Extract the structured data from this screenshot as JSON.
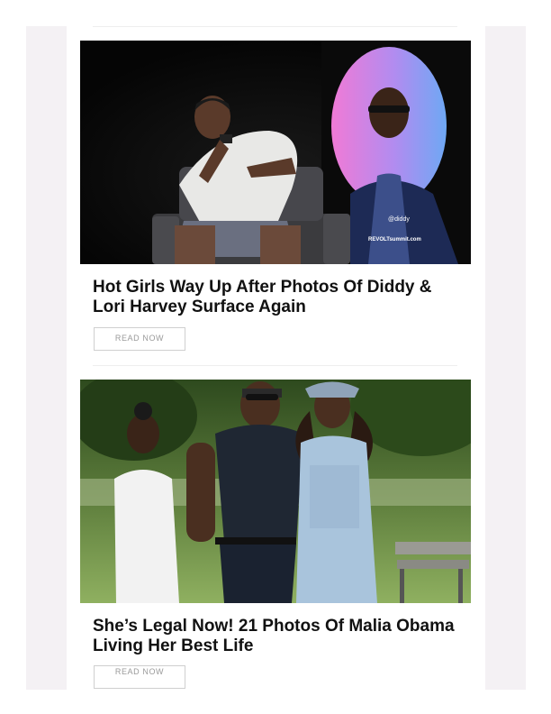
{
  "feed": {
    "articles": [
      {
        "image_alt": "Diddy on stage with microphone, @diddy and REVOLTsummit.com on backdrop screen",
        "headline": "Hot Girls Way Up After Photos Of Diddy & Lori Harvey Surface Again",
        "button_label": "READ NOW",
        "image_caption_lines": [
          "@diddy",
          "REVOLTsummit.com"
        ]
      },
      {
        "image_alt": "Barack Obama walking with Malia and Sasha in a park",
        "headline": "She’s Legal Now! 21 Photos Of Malia Obama Living Her Best Life",
        "button_label": "READ NOW"
      }
    ]
  },
  "colors": {
    "gutter": "#f4f1f4",
    "headline": "#111111",
    "button_border": "#cfcfcf",
    "button_text": "#9a9a9a"
  }
}
